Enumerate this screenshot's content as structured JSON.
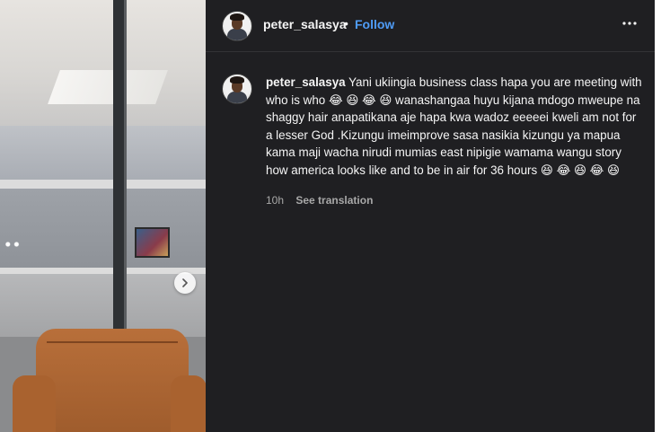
{
  "post": {
    "username": "peter_salasya",
    "separator": "•",
    "follow_label": "Follow",
    "more_icon": "more-options-icon"
  },
  "media": {
    "next_icon": "chevron-right-icon"
  },
  "caption": {
    "username": "peter_salasya",
    "text": " Yani ukiingia business class hapa you are meeting with who is who 😂 😆 😂 😆 wanashangaa huyu kijana mdogo mweupe na shaggy hair anapatikana aje hapa kwa wadoz eeeeei kweli am not for a lesser God .Kizungu imeimprove sasa nasikia kizungu ya mapua kama maji wacha nirudi mumias east nipigie wamama wangu story how america looks like and to be in air for 36 hours 😆 😂 😆 😂 😆",
    "time": "10h",
    "translate_label": "See translation"
  },
  "colors": {
    "panel_bg": "#1f1f22",
    "follow_blue": "#4f9cf7",
    "meta_gray": "#a8a8a8"
  }
}
